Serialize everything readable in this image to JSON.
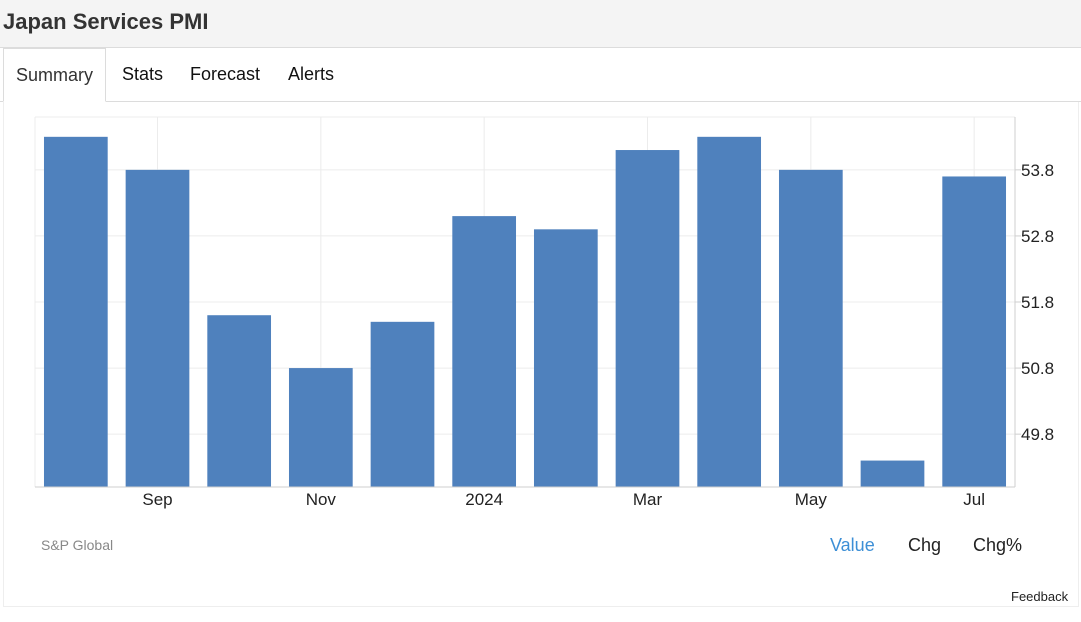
{
  "header": {
    "title": "Japan Services PMI"
  },
  "tabs": [
    {
      "label": "Summary",
      "active": true
    },
    {
      "label": "Stats",
      "active": false
    },
    {
      "label": "Forecast",
      "active": false
    },
    {
      "label": "Alerts",
      "active": false
    }
  ],
  "source_label": "S&P Global",
  "toggles": [
    {
      "label": "Value",
      "active": true
    },
    {
      "label": "Chg",
      "active": false
    },
    {
      "label": "Chg%",
      "active": false
    }
  ],
  "feedback_label": "Feedback",
  "colors": {
    "bar": "#4f81bd",
    "active_toggle": "#3d8fd6",
    "grid": "#ececec"
  },
  "chart_data": {
    "type": "bar",
    "categories": [
      "Aug 2023",
      "Sep 2023",
      "Oct 2023",
      "Nov 2023",
      "Dec 2023",
      "Jan 2024",
      "Feb 2024",
      "Mar 2024",
      "Apr 2024",
      "May 2024",
      "Jun 2024",
      "Jul 2024"
    ],
    "x_tick_labels": [
      "Sep",
      "Nov",
      "2024",
      "Mar",
      "May",
      "Jul"
    ],
    "x_tick_indices": [
      1,
      3,
      5,
      7,
      9,
      11
    ],
    "values": [
      54.3,
      53.8,
      51.6,
      50.8,
      51.5,
      53.1,
      52.9,
      54.1,
      54.3,
      53.8,
      49.4,
      53.7
    ],
    "y_ticks": [
      49.8,
      50.8,
      51.8,
      52.8,
      53.8
    ],
    "ylim": [
      49.0,
      54.6
    ],
    "y_axis_position": "right",
    "grid": true
  }
}
